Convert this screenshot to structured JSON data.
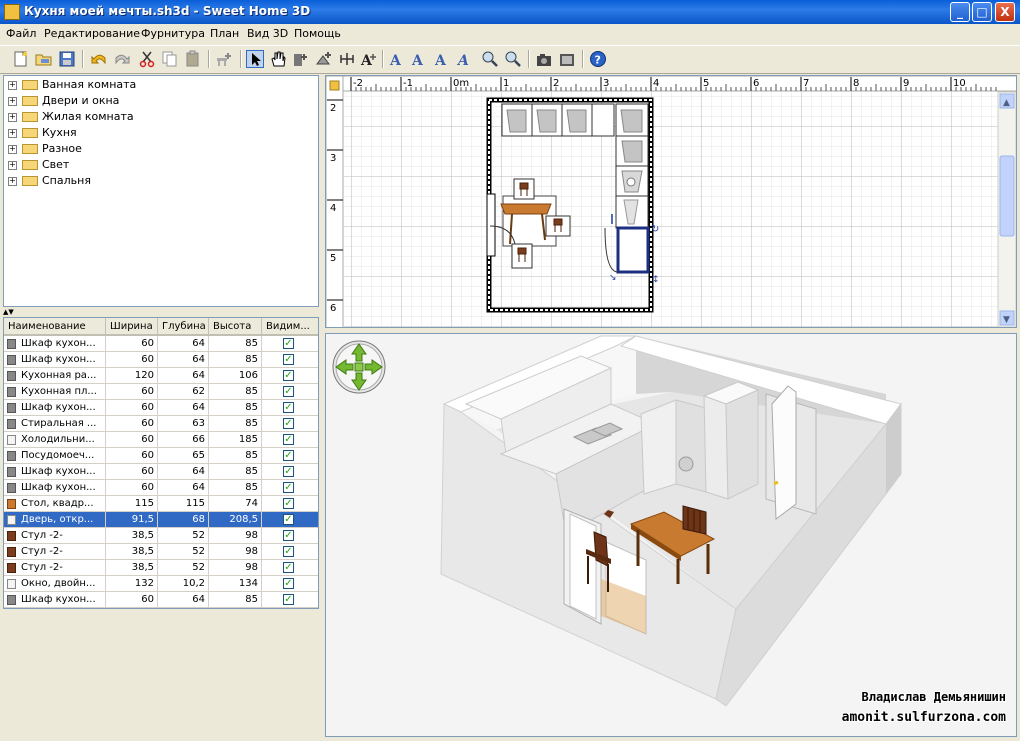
{
  "window": {
    "title": "Кухня моей мечты.sh3d - Sweet Home 3D",
    "minimize_glyph": "_",
    "maximize_glyph": "□",
    "close_glyph": "X"
  },
  "menu": [
    "Файл",
    "Редактирование",
    "Фурнитура",
    "План",
    "Вид 3D",
    "Помощь"
  ],
  "toolbar_icons": [
    "new-file-icon",
    "open-icon",
    "save-icon",
    "undo-icon",
    "redo-icon",
    "cut-icon",
    "copy-icon",
    "paste-icon",
    "add-furniture-icon",
    "select-arrow-icon",
    "pan-hand-icon",
    "create-walls-icon",
    "create-rooms-icon",
    "create-dimensions-icon",
    "add-text-icon",
    "text-style-icon-1",
    "text-style-icon-2",
    "text-style-icon-3",
    "text-style-icon-4",
    "zoom-in-icon",
    "zoom-out-icon",
    "photo-camera-icon",
    "video-icon",
    "help-icon"
  ],
  "catalog": {
    "categories": [
      "Ванная комната",
      "Двери и окна",
      "Жилая комната",
      "Кухня",
      "Разное",
      "Свет",
      "Спальня"
    ]
  },
  "furniture": {
    "columns": [
      "Наименование",
      "Ширина",
      "Глубина",
      "Высота",
      "Видим..."
    ],
    "rows": [
      {
        "name": "Шкаф кухон...",
        "width": "60",
        "depth": "64",
        "height": "85",
        "visible": true,
        "icon": "cabinet-icon"
      },
      {
        "name": "Шкаф кухон...",
        "width": "60",
        "depth": "64",
        "height": "85",
        "visible": true,
        "icon": "cabinet-icon"
      },
      {
        "name": "Кухонная ра...",
        "width": "120",
        "depth": "64",
        "height": "106",
        "visible": true,
        "icon": "sink-icon"
      },
      {
        "name": "Кухонная пл...",
        "width": "60",
        "depth": "62",
        "height": "85",
        "visible": true,
        "icon": "stove-icon"
      },
      {
        "name": "Шкаф кухон...",
        "width": "60",
        "depth": "64",
        "height": "85",
        "visible": true,
        "icon": "cabinet-icon"
      },
      {
        "name": "Стиральная ...",
        "width": "60",
        "depth": "63",
        "height": "85",
        "visible": true,
        "icon": "washer-icon"
      },
      {
        "name": "Холодильни...",
        "width": "60",
        "depth": "66",
        "height": "185",
        "visible": true,
        "icon": "fridge-icon"
      },
      {
        "name": "Посудомоеч...",
        "width": "60",
        "depth": "65",
        "height": "85",
        "visible": true,
        "icon": "dishwasher-icon"
      },
      {
        "name": "Шкаф кухон...",
        "width": "60",
        "depth": "64",
        "height": "85",
        "visible": true,
        "icon": "cabinet-icon"
      },
      {
        "name": "Шкаф кухон...",
        "width": "60",
        "depth": "64",
        "height": "85",
        "visible": true,
        "icon": "cabinet-icon"
      },
      {
        "name": "Стол, квадр...",
        "width": "115",
        "depth": "115",
        "height": "74",
        "visible": true,
        "icon": "table-icon"
      },
      {
        "name": "Дверь, откр...",
        "width": "91,5",
        "depth": "68",
        "height": "208,5",
        "visible": true,
        "icon": "door-icon",
        "selected": true
      },
      {
        "name": "Стул -2-",
        "width": "38,5",
        "depth": "52",
        "height": "98",
        "visible": true,
        "icon": "chair-icon"
      },
      {
        "name": "Стул -2-",
        "width": "38,5",
        "depth": "52",
        "height": "98",
        "visible": true,
        "icon": "chair-icon"
      },
      {
        "name": "Стул -2-",
        "width": "38,5",
        "depth": "52",
        "height": "98",
        "visible": true,
        "icon": "chair-icon"
      },
      {
        "name": "Окно, двойн...",
        "width": "132",
        "depth": "10,2",
        "height": "134",
        "visible": true,
        "icon": "window-icon"
      },
      {
        "name": "Шкаф кухон...",
        "width": "60",
        "depth": "64",
        "height": "85",
        "visible": true,
        "icon": "cabinet-icon"
      }
    ]
  },
  "plan": {
    "ruler_x_labels": [
      "-2",
      "-1",
      "0m",
      "1",
      "2",
      "3",
      "4",
      "5",
      "6",
      "7",
      "8",
      "9",
      "10"
    ],
    "ruler_y_labels": [
      "2",
      "3",
      "4",
      "5",
      "6"
    ]
  },
  "watermark": {
    "line1": "Владислав Демьянишин",
    "line2": "amonit.sulfurzona.com"
  },
  "colors": {
    "title_bar": "#0a5fd8",
    "selection": "#316ac5",
    "checkbox_tick": "#21a121",
    "table_wood": "#c87a30",
    "chair_wood": "#6e3418",
    "grid_line": "#d8d8d8"
  }
}
